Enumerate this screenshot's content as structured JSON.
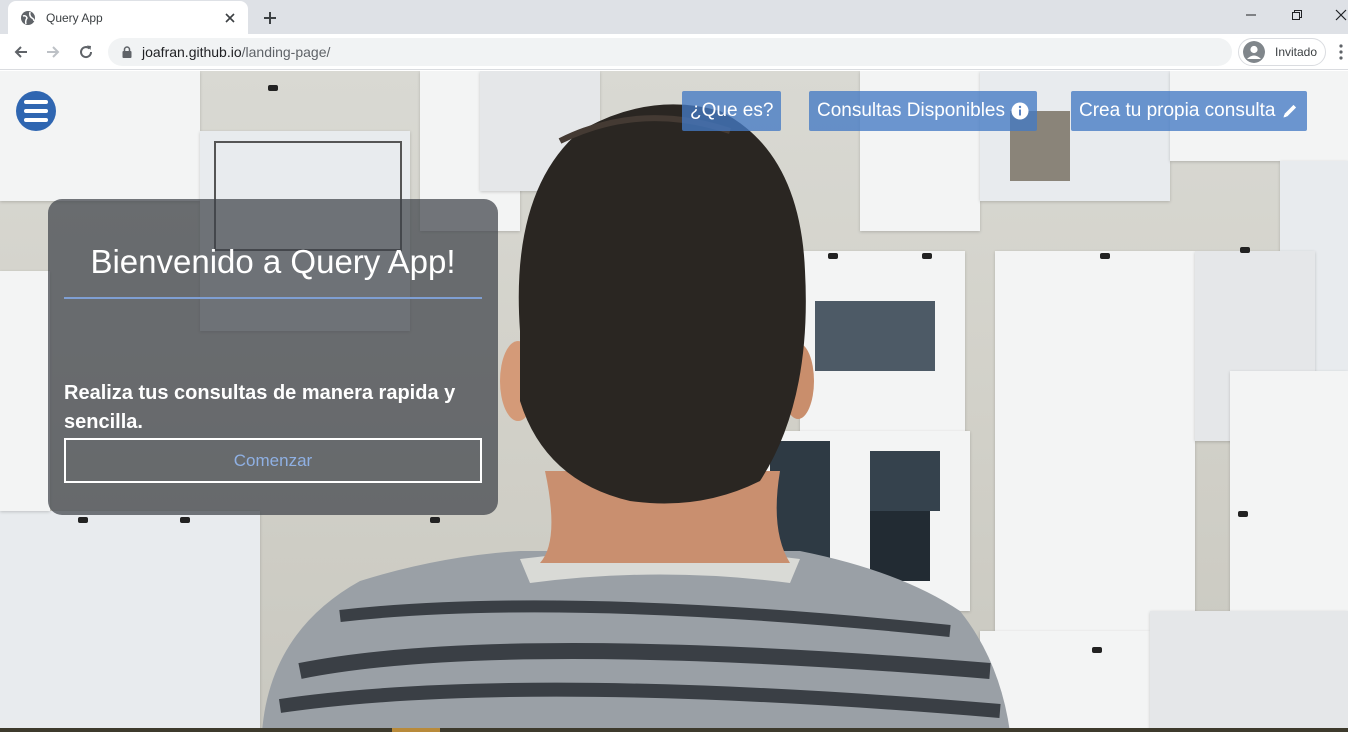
{
  "browser": {
    "tab_title": "Query App",
    "url_host": "joafran.github.io",
    "url_path": "/landing-page/",
    "profile_label": "Invitado"
  },
  "nav": {
    "items": [
      {
        "label": "¿Que es?",
        "icon": ""
      },
      {
        "label": "Consultas Disponibles",
        "icon": "info-circle-icon"
      },
      {
        "label": "Crea tu propia consulta",
        "icon": "pencil-icon"
      }
    ]
  },
  "hero": {
    "title": "Bienvenido a Query App!",
    "text": "Realiza tus consultas de manera rapida y sencilla.",
    "button_label": "Comenzar"
  },
  "colors": {
    "accent": "#2f66b1",
    "nav_button": "#447ac4",
    "card": "#3e424a"
  }
}
